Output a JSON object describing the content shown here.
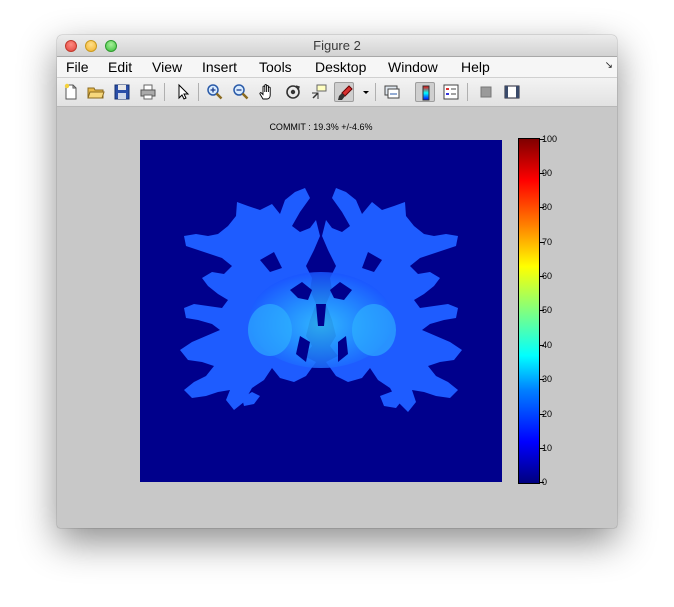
{
  "window": {
    "title": "Figure 2"
  },
  "menu": [
    "File",
    "Edit",
    "View",
    "Insert",
    "Tools",
    "Desktop",
    "Window",
    "Help"
  ],
  "toolbar": {
    "icons": [
      "new-figure-icon",
      "open-file-icon",
      "save-icon",
      "print-icon",
      "edit-plot-arrow-icon",
      "zoom-in-icon",
      "zoom-out-icon",
      "pan-hand-icon",
      "rotate-3d-icon",
      "data-cursor-icon",
      "brush-icon",
      "brush-dropdown-icon",
      "link-plot-icon",
      "insert-colorbar-icon",
      "insert-legend-icon",
      "hide-plot-tools-icon",
      "show-plot-tools-icon"
    ]
  },
  "figure": {
    "axes_title": "COMMIT : 19.3% +/-4.6%",
    "colormap": "jet",
    "colorbar": {
      "ticks": [
        "100",
        "90",
        "80",
        "70",
        "60",
        "50",
        "40",
        "30",
        "20",
        "10",
        "0"
      ],
      "range": [
        0,
        100
      ]
    },
    "background_color": "#00008c"
  }
}
